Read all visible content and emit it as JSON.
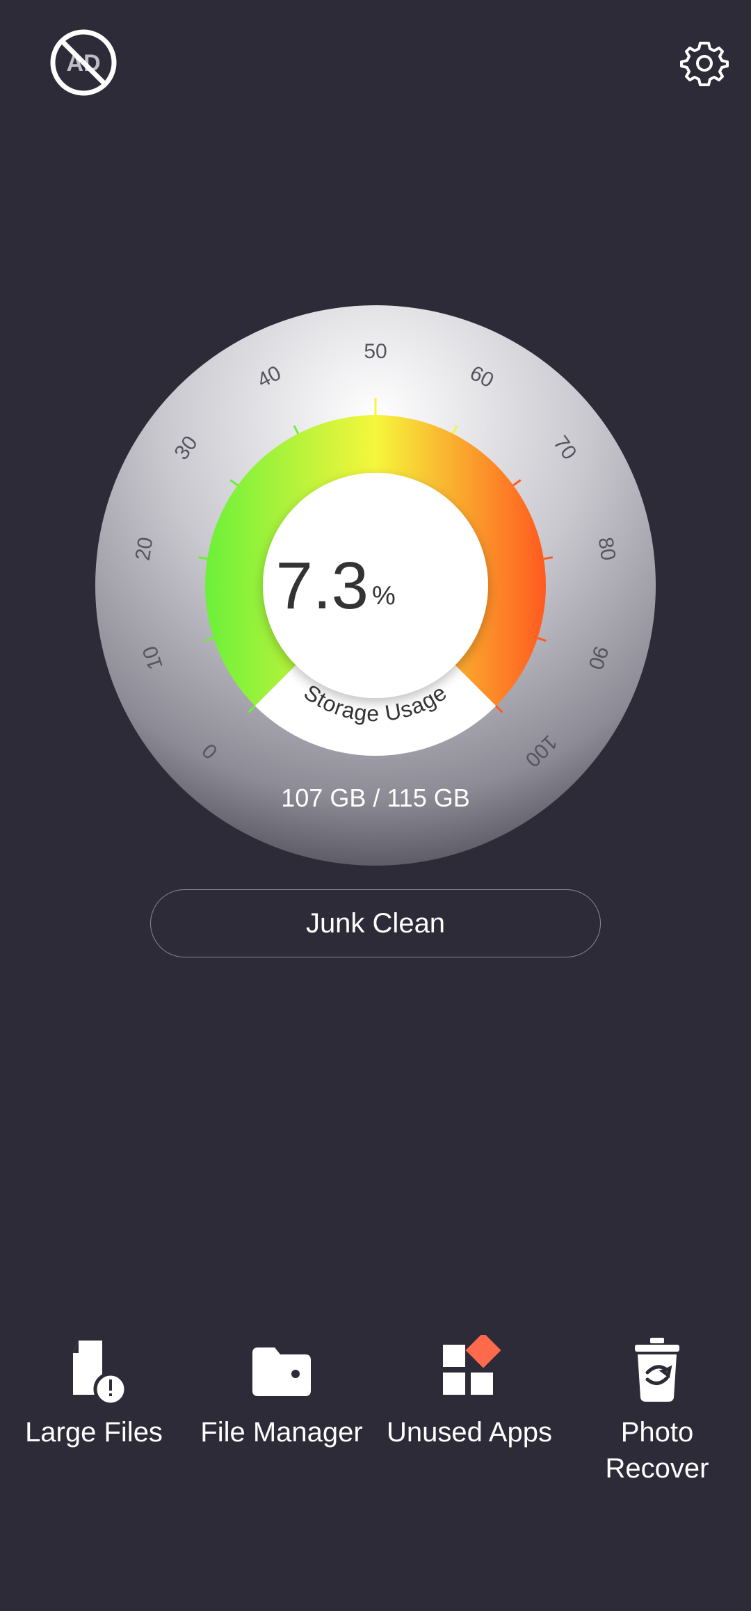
{
  "header": {
    "no_ads_icon_text": "AD"
  },
  "gauge": {
    "title": "Storage Usage",
    "percent_value": "7.3",
    "percent_unit": "%",
    "storage_text": "107 GB / 115 GB",
    "ticks": [
      "0",
      "10",
      "20",
      "30",
      "40",
      "50",
      "60",
      "70",
      "80",
      "90",
      "100"
    ],
    "colors": {
      "low": "#6cf03a",
      "mid": "#f6f63c",
      "high": "#ff5a1f"
    }
  },
  "junk_clean": {
    "label": "Junk Clean"
  },
  "tools": [
    {
      "label": "Large Files",
      "icon": "large-files-icon"
    },
    {
      "label": "File Manager",
      "icon": "folder-icon"
    },
    {
      "label": "Unused Apps",
      "icon": "unused-apps-icon"
    },
    {
      "label": "Photo\nRecover",
      "icon": "trash-recover-icon"
    }
  ],
  "accent": "#ff6a4d"
}
